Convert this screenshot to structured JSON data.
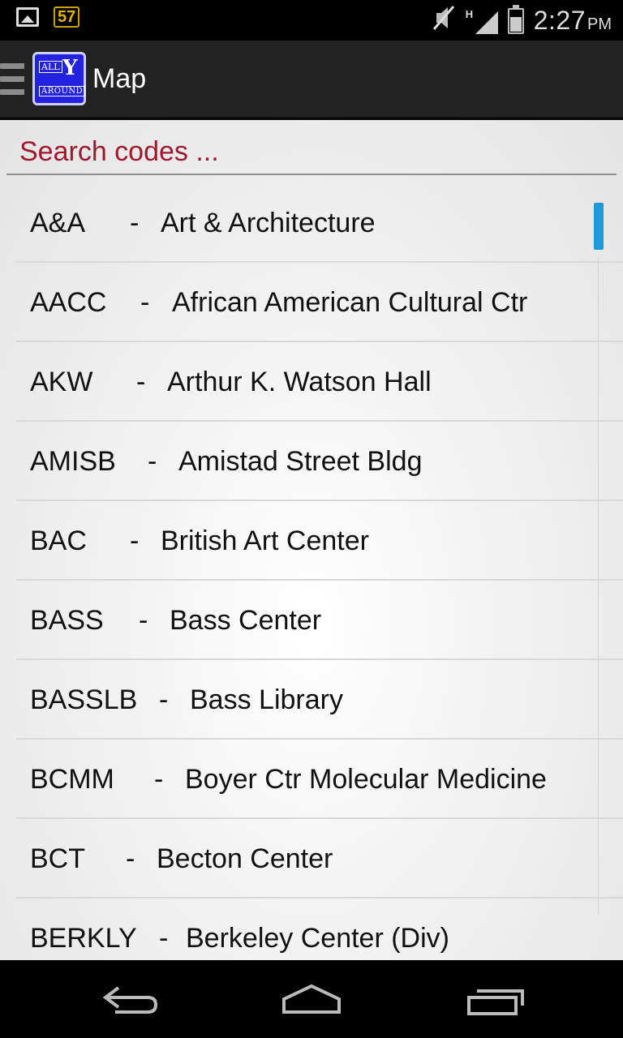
{
  "status_bar": {
    "notification_badge": "57",
    "signal_type": "H",
    "time": "2:27",
    "ampm": "PM",
    "icons": [
      "image-icon",
      "mute-icon",
      "signal-icon",
      "battery-icon"
    ]
  },
  "action_bar": {
    "title": "Map",
    "logo_line1": "ALL",
    "logo_letter": "Y",
    "logo_line2": "AROUND"
  },
  "search": {
    "placeholder": "Search codes ...",
    "value": ""
  },
  "list": {
    "items": [
      {
        "code": "A&A",
        "sep": "-",
        "name": "Art & Architecture"
      },
      {
        "code": "AACC",
        "sep": "-",
        "name": "African American Cultural Ctr"
      },
      {
        "code": "AKW",
        "sep": "-",
        "name": "Arthur K. Watson Hall"
      },
      {
        "code": "AMISB",
        "sep": "-",
        "name": "Amistad Street Bldg"
      },
      {
        "code": "BAC",
        "sep": "-",
        "name": "British Art Center"
      },
      {
        "code": "BASS",
        "sep": "-",
        "name": "Bass Center"
      },
      {
        "code": "BASSLB",
        "sep": "-",
        "name": "Bass Library"
      },
      {
        "code": "BCMM",
        "sep": "-",
        "name": "Boyer Ctr Molecular Medicine"
      },
      {
        "code": "BCT",
        "sep": "-",
        "name": "Becton Center"
      },
      {
        "code": "BERKLY",
        "sep": "-",
        "name": "Berkeley Center (Div)"
      }
    ]
  },
  "colors": {
    "placeholder": "#a0182e",
    "scroll_accent": "#1e9ad6",
    "action_bar": "#222222",
    "logo_bg": "#2222e0"
  }
}
